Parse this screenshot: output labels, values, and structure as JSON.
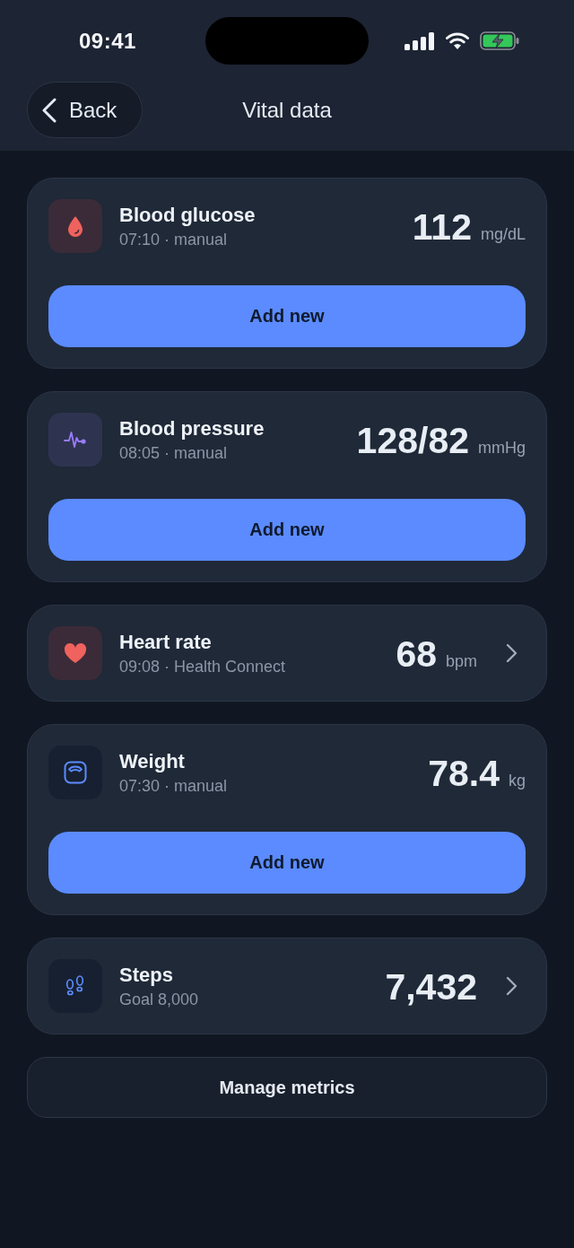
{
  "status_bar": {
    "time": "09:41"
  },
  "nav": {
    "back": "Back",
    "title": "Vital data"
  },
  "metrics": [
    {
      "kind": "entry",
      "title": "Blood glucose",
      "subtitle": "07:10 · manual",
      "value": "112",
      "unit": "mg/dL",
      "button": "Add new"
    },
    {
      "kind": "entry",
      "title": "Blood pressure",
      "subtitle": "08:05 · manual",
      "value": "128/82",
      "unit": "mmHg",
      "button": "Add new"
    },
    {
      "kind": "link",
      "title": "Heart rate",
      "subtitle": "09:08 · Health Connect",
      "value": "68",
      "unit": "bpm"
    },
    {
      "kind": "entry",
      "title": "Weight",
      "subtitle": "07:30 · manual",
      "value": "78.4",
      "unit": "kg",
      "button": "Add new"
    },
    {
      "kind": "link",
      "title": "Steps",
      "subtitle": "Goal 8,000",
      "value": "7,432"
    }
  ],
  "footer_button": "Manage metrics"
}
